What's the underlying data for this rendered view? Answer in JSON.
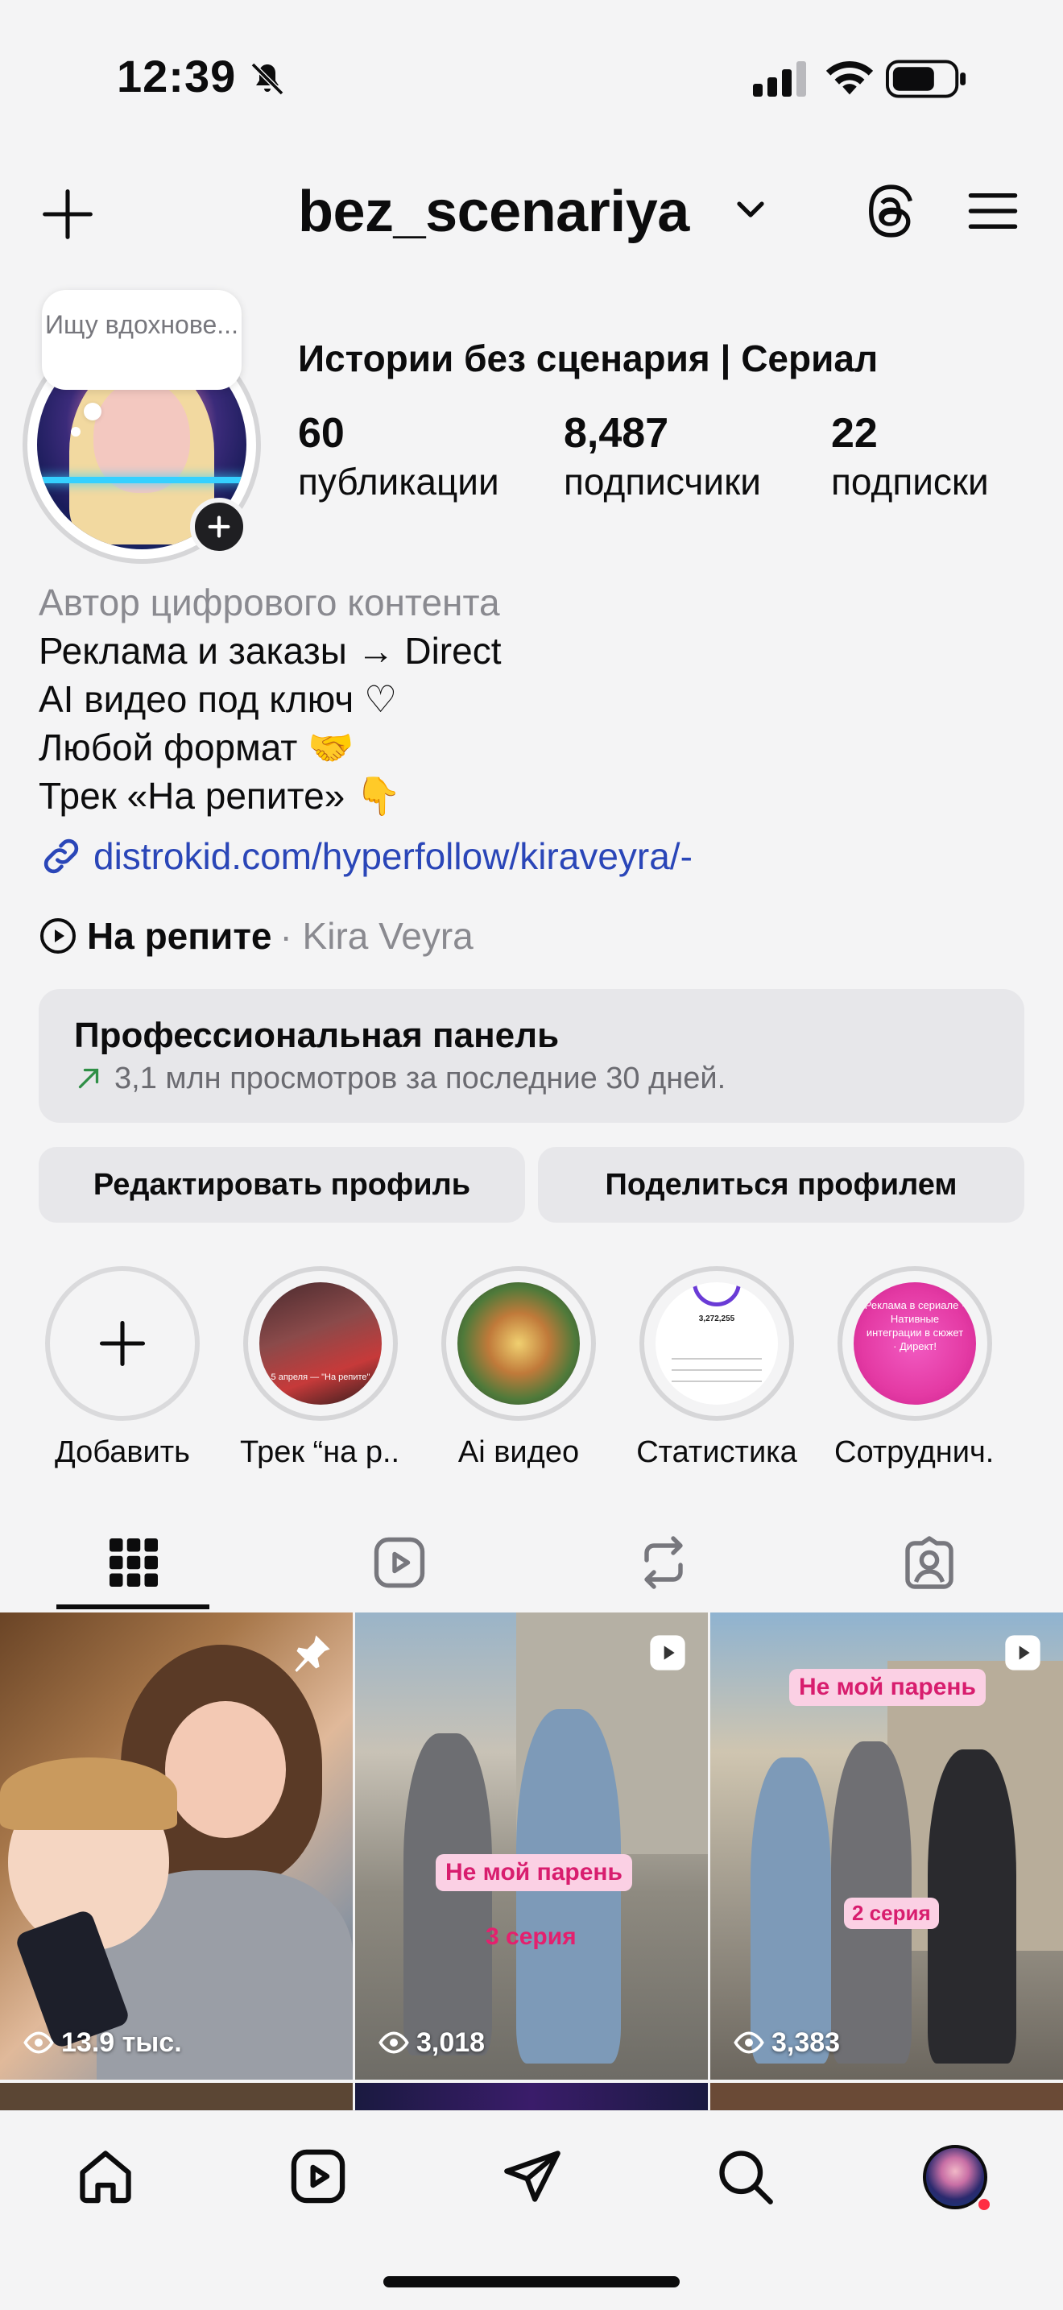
{
  "status_bar": {
    "time": "12:39"
  },
  "header": {
    "username": "bez_scenariya"
  },
  "profile": {
    "note": "Ищу вдохнове...",
    "display_name": "Истории без сценария | Сериал",
    "stats": [
      {
        "value": "60",
        "label": "публикации"
      },
      {
        "value": "8,487",
        "label": "подписчики"
      },
      {
        "value": "22",
        "label": "подписки"
      }
    ],
    "category": "Автор цифрового контента",
    "bio_lines": [
      "Реклама и заказы → Direct",
      "AI видео под ключ ♡",
      "Любой формат 🤝",
      "Трек «На репите» 👇"
    ],
    "link": "distrokid.com/hyperfollow/kiraveyra/-",
    "music": {
      "title": "На репите",
      "artist": "· Kira Veyra"
    }
  },
  "pro_panel": {
    "title": "Профессиональная панель",
    "subtitle": "3,1 млн просмотров за последние 30 дней."
  },
  "buttons": {
    "edit": "Редактировать профиль",
    "share": "Поделиться профилем"
  },
  "highlights": [
    {
      "label": "Добавить",
      "inner_text": ""
    },
    {
      "label": "Трек “на р...",
      "inner_text": "5 апреля — \"На репите\""
    },
    {
      "label": "Ai видео",
      "inner_text": ""
    },
    {
      "label": "Статистика",
      "inner_text": "3,272,255"
    },
    {
      "label": "Сотруднич...",
      "inner_text": "Реклама в сериале · Нативные интеграции в сюжет · Директ!"
    }
  ],
  "posts": [
    {
      "views": "13.9 тыс.",
      "pinned": true
    },
    {
      "views": "3,018",
      "title_tag": "Не мой парень",
      "episode": "3 серия",
      "reel": true
    },
    {
      "views": "3,383",
      "title_tag": "Не мой парень",
      "episode": "2 серия",
      "reel": true
    }
  ],
  "colors": {
    "accent_link": "#2a46b8",
    "tag_bg": "#fbd0e4",
    "tag_text": "#d81d6e",
    "notification_dot": "#ff2d43"
  }
}
